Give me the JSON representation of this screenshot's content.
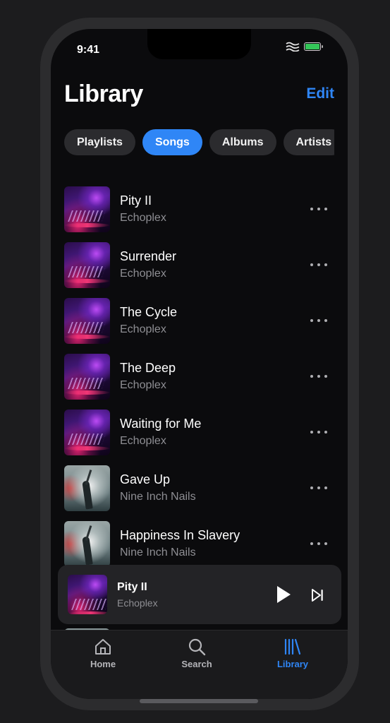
{
  "status": {
    "time": "9:41"
  },
  "header": {
    "title": "Library",
    "edit_label": "Edit"
  },
  "chips": [
    {
      "label": "Playlists",
      "active": false
    },
    {
      "label": "Songs",
      "active": true
    },
    {
      "label": "Albums",
      "active": false
    },
    {
      "label": "Artists",
      "active": false
    }
  ],
  "songs": [
    {
      "title": "Pity II",
      "artist": "Echoplex",
      "artwork": "echoplex-album-art"
    },
    {
      "title": "Surrender",
      "artist": "Echoplex",
      "artwork": "echoplex-album-art"
    },
    {
      "title": "The Cycle",
      "artist": "Echoplex",
      "artwork": "echoplex-album-art"
    },
    {
      "title": "The Deep",
      "artist": "Echoplex",
      "artwork": "echoplex-album-art"
    },
    {
      "title": "Waiting for Me",
      "artist": "Echoplex",
      "artwork": "echoplex-album-art"
    },
    {
      "title": "Gave Up",
      "artist": "Nine Inch Nails",
      "artwork": "nine-inch-nails-album-art"
    },
    {
      "title": "Happiness In Slavery",
      "artist": "Nine Inch Nails",
      "artwork": "nine-inch-nails-album-art"
    }
  ],
  "now_playing": {
    "title": "Pity II",
    "artist": "Echoplex",
    "play_icon": "play-icon",
    "next_icon": "skip-forward-icon"
  },
  "tabs": [
    {
      "label": "Home",
      "icon": "home-icon",
      "active": false
    },
    {
      "label": "Search",
      "icon": "search-icon",
      "active": false
    },
    {
      "label": "Library",
      "icon": "library-icon",
      "active": true
    }
  ],
  "colors": {
    "accent": "#2f86f6",
    "background": "#0b0b0d",
    "battery": "#34c759"
  }
}
